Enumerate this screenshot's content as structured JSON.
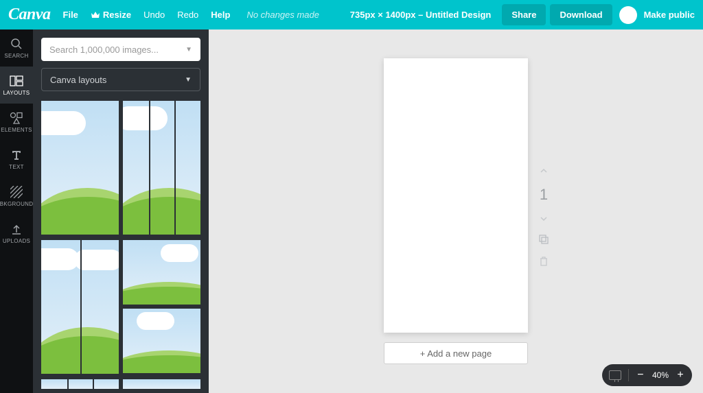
{
  "topbar": {
    "logo": "Canva",
    "file": "File",
    "resize": "Resize",
    "undo": "Undo",
    "redo": "Redo",
    "help": "Help",
    "status": "No changes made",
    "doc_title": "735px × 1400px – Untitled Design",
    "share": "Share",
    "download": "Download",
    "make_public": "Make public"
  },
  "rail": {
    "items": [
      {
        "label": "SEARCH"
      },
      {
        "label": "LAYOUTS"
      },
      {
        "label": "ELEMENTS"
      },
      {
        "label": "TEXT"
      },
      {
        "label": "BKGROUND"
      },
      {
        "label": "UPLOADS"
      }
    ]
  },
  "panel": {
    "search_placeholder": "Search 1,000,000 images...",
    "filter": "Canva layouts"
  },
  "canvas": {
    "page_number": "1",
    "add_page": "+ Add a new page",
    "zoom": "40%"
  }
}
